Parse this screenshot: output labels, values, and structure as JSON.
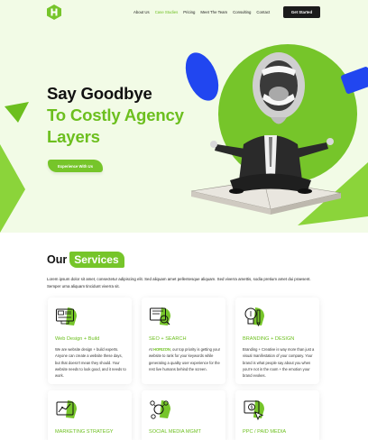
{
  "nav": {
    "items": [
      "About Us",
      "Case Studies",
      "Pricing",
      "Meet The Team",
      "Consulting",
      "Contact"
    ],
    "active_index": 1,
    "cta": "Get Started"
  },
  "hero": {
    "line1": "Say Goodbye",
    "line2": "To Costly Agency",
    "line3": "Layers",
    "button": "Experience With Us"
  },
  "services": {
    "title_plain": "Our",
    "title_highlight": "Services",
    "description": "Lorem ipsum dolor sit amet, consectetur adipiscing elit. Sed aliquam amet pellentesque aliquam. Sed viverra amettis, sodia pretium amet dui praesent. Semper urna aliquam tincidunt viverra sit.",
    "cards": [
      {
        "title": "Web Design + Build",
        "icon": "website-design-icon",
        "desc_before": "We are website design + build experts. Anyone can create a website these days, but that doesn't mean they should. Your website needs to look good, and it needs to work.",
        "desc_highlight": "",
        "desc_after": ""
      },
      {
        "title": "SEO + SEARCH",
        "icon": "seo-search-icon",
        "desc_before": "At ",
        "desc_highlight": "HORIZON",
        "desc_after": ", our top priority is getting your website to rank for your keywords while generating a quality user experience for the rest live humans behind the screen."
      },
      {
        "title": "BRANDING + DESIGN",
        "icon": "branding-design-icon",
        "desc_before": "Branding + Creative is way more than just a visual manifestation of your company. Your brand is what people say about you when you're not in the room + the emotion your brand evokes.",
        "desc_highlight": "",
        "desc_after": ""
      },
      {
        "title": "MARKETING STRATEGY",
        "icon": "marketing-strategy-icon"
      },
      {
        "title": "SOCIAL MEDIA MGMT",
        "icon": "social-media-icon"
      },
      {
        "title": "PPC / PAID MEDIA",
        "icon": "ppc-paid-media-icon"
      }
    ]
  },
  "colors": {
    "brand_green": "#76c52a",
    "text_green": "#6cbf1e",
    "hero_bg": "#f2fbe6",
    "accent_blue": "#2146f0",
    "dark": "#1b1b1b"
  }
}
